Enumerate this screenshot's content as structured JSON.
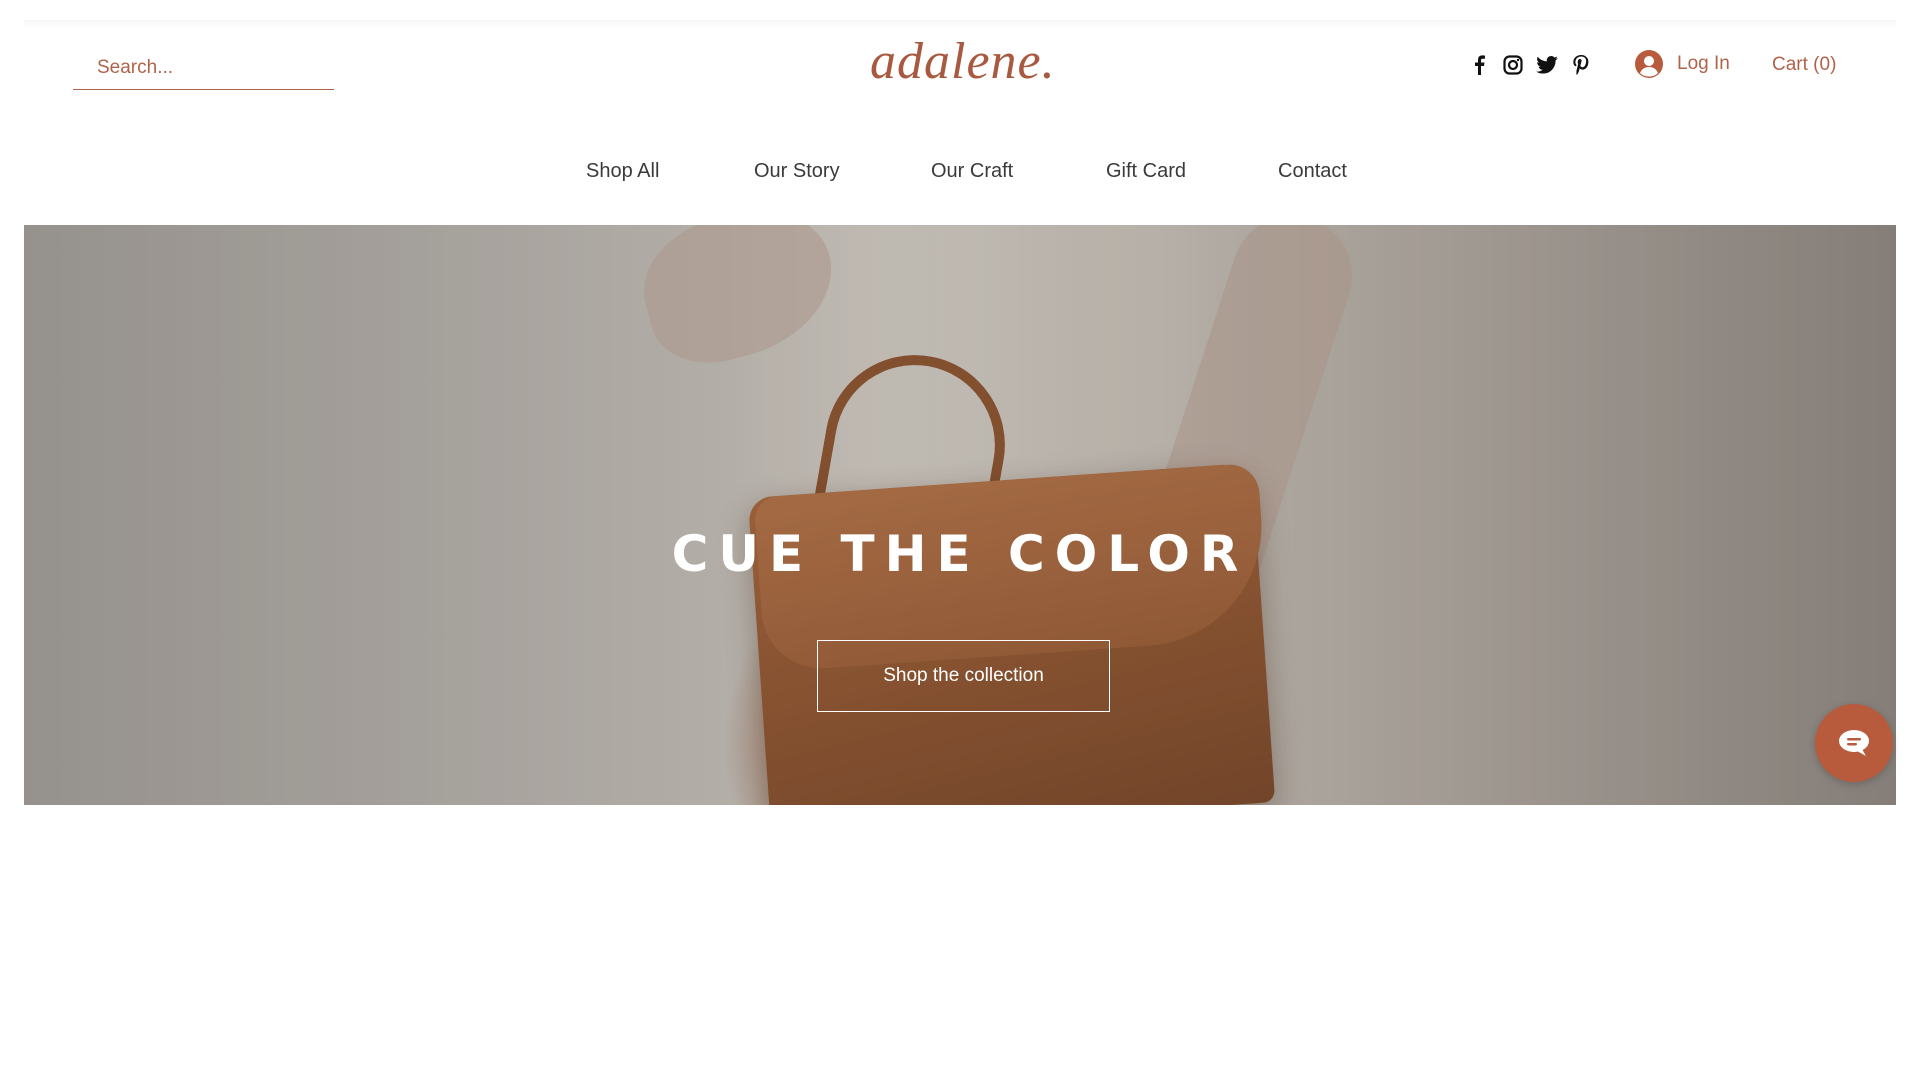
{
  "header": {
    "search": {
      "placeholder": "Search..."
    },
    "logo": "adalene.",
    "social": [
      "facebook-icon",
      "instagram-icon",
      "twitter-icon",
      "pinterest-icon"
    ],
    "login_label": "Log In",
    "cart_label": "Cart (0)"
  },
  "nav": {
    "items": [
      {
        "label": "Shop All"
      },
      {
        "label": "Our Story"
      },
      {
        "label": "Our Craft"
      },
      {
        "label": "Gift Card"
      },
      {
        "label": "Contact"
      }
    ]
  },
  "hero": {
    "title": "CUE THE COLOR",
    "button_label": "Shop the collection"
  },
  "chat": {
    "icon": "chat-icon"
  },
  "colors": {
    "accent": "#b1634a",
    "logo": "#a85a40",
    "chat_button": "#b85b3d",
    "nav_text": "#3a3a3a"
  }
}
